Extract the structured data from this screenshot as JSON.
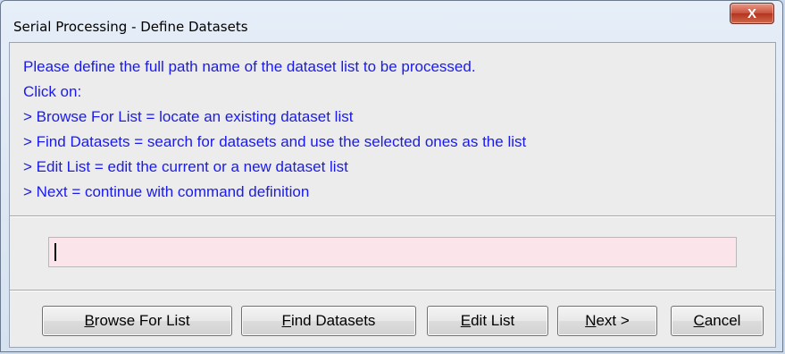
{
  "window": {
    "title": "Serial Processing - Define Datasets",
    "close_label": "X"
  },
  "instructions": [
    "Please define the full path name of the dataset list to be processed.",
    "Click on:",
    "> Browse For List = locate an existing dataset list",
    "> Find Datasets = search for datasets and use the selected ones as the list",
    "> Edit List = edit the current or a new dataset list",
    "> Next = continue with command definition"
  ],
  "path_input": {
    "value": "",
    "placeholder": ""
  },
  "buttons": {
    "browse": {
      "mnemonic": "B",
      "rest": "rowse For List"
    },
    "find": {
      "mnemonic": "F",
      "rest": "ind Datasets"
    },
    "edit": {
      "mnemonic": "E",
      "rest": "dit List"
    },
    "next": {
      "mnemonic": "N",
      "rest": "ext >"
    },
    "cancel": {
      "mnemonic": "C",
      "rest": "ancel"
    }
  },
  "colors": {
    "instruction_text": "#1a1aee",
    "input_background": "#fbe5ea",
    "close_button": "#c9503b"
  }
}
